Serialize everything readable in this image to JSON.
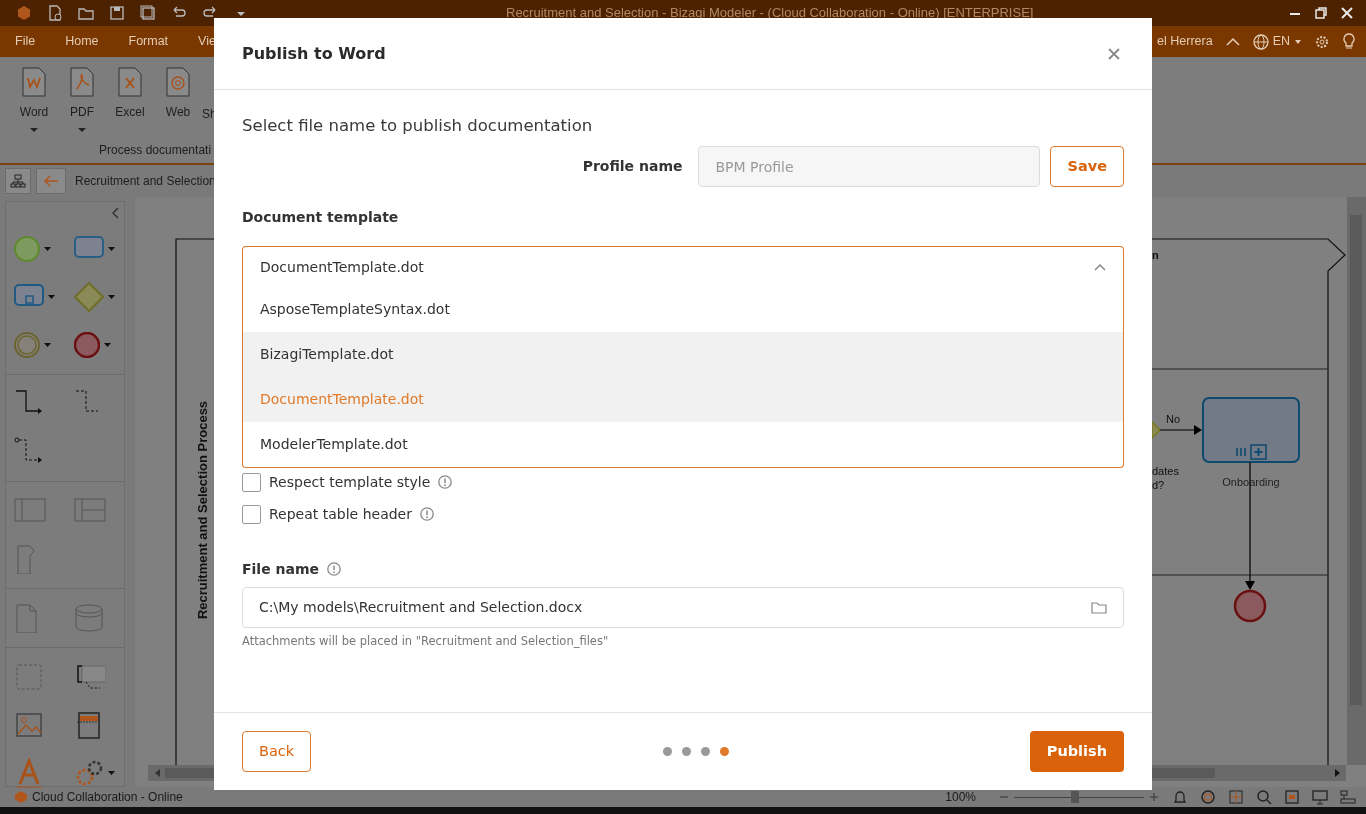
{
  "app": {
    "title": "Recruitment and Selection - Bizagi Modeler - (Cloud Collaboration - Online) [ENTERPRISE]"
  },
  "menu": [
    {
      "label": "File"
    },
    {
      "label": "Home"
    },
    {
      "label": "Format"
    },
    {
      "label": "Vie"
    }
  ],
  "account": {
    "user": "el Herrera",
    "language": "EN"
  },
  "ribbon": {
    "buttons": [
      {
        "label": "Word",
        "kind": "word",
        "dropdown": true
      },
      {
        "label": "PDF",
        "kind": "pdf",
        "dropdown": true
      },
      {
        "label": "Excel",
        "kind": "excel",
        "dropdown": false
      },
      {
        "label": "Web",
        "kind": "web",
        "dropdown": false
      },
      {
        "label": "Sh",
        "kind": "cut",
        "dropdown": false
      }
    ],
    "group": "Process documentati"
  },
  "document_tab": "Recruitment and Selection",
  "diagram": {
    "pool": "Recruitment and Selection Process",
    "lane": "n",
    "flow_label": "No",
    "gateway_label": [
      "dates",
      "d?"
    ],
    "task": "Onboarding"
  },
  "status_bar": {
    "text": "Cloud Collaboration - Online",
    "zoom": "100%",
    "level": 0.47
  },
  "dialog": {
    "title": "Publish to Word",
    "heading": "Select file name to publish documentation",
    "profile": {
      "label": "Profile name",
      "value": "BPM Profile",
      "disabled": true,
      "button": "Save"
    },
    "template": {
      "label": "Document template",
      "value": "DocumentTemplate.dot",
      "expanded": true,
      "options": [
        {
          "label": "AsposeTemplateSyntax.dot",
          "selected": false,
          "hovered": false
        },
        {
          "label": "BizagiTemplate.dot",
          "selected": false,
          "hovered": true
        },
        {
          "label": "DocumentTemplate.dot",
          "selected": true,
          "hovered": true
        },
        {
          "label": "ModelerTemplate.dot",
          "selected": false,
          "hovered": false
        }
      ]
    },
    "checkboxes": [
      {
        "label": "Respect template style",
        "checked": false
      },
      {
        "label": "Repeat table header",
        "checked": false
      }
    ],
    "file": {
      "label": "File name",
      "value": "C:\\My models\\Recruitment and Selection.docx",
      "hint": "Attachments will be placed in \"Recruitment and Selection_files\""
    },
    "steps": [
      {
        "selected": false
      },
      {
        "selected": false
      },
      {
        "selected": false
      },
      {
        "selected": true
      }
    ],
    "back": "Back",
    "publish": "Publish"
  }
}
